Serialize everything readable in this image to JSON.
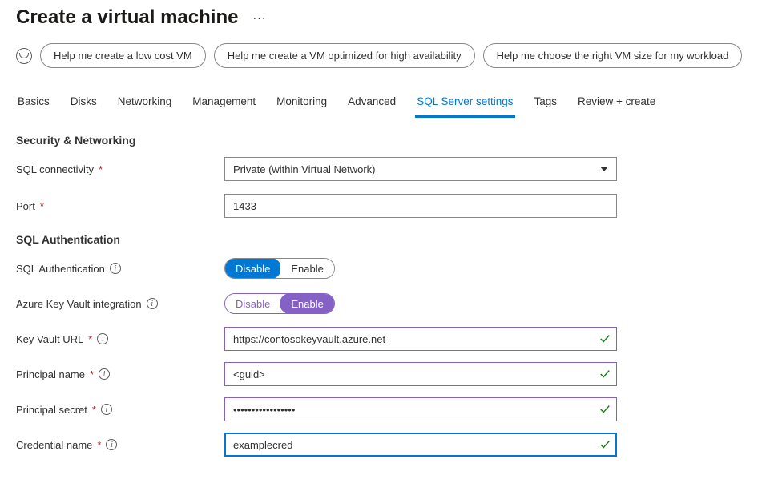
{
  "header": {
    "title": "Create a virtual machine"
  },
  "suggestions": {
    "items": [
      "Help me create a low cost VM",
      "Help me create a VM optimized for high availability",
      "Help me choose the right VM size for my workload"
    ]
  },
  "tabs": {
    "items": [
      "Basics",
      "Disks",
      "Networking",
      "Management",
      "Monitoring",
      "Advanced",
      "SQL Server settings",
      "Tags",
      "Review + create"
    ],
    "activeIndex": 6
  },
  "sectionSecurity": {
    "heading": "Security & Networking",
    "sqlConnectivityLabel": "SQL connectivity",
    "sqlConnectivityValue": "Private (within Virtual Network)",
    "portLabel": "Port",
    "portValue": "1433"
  },
  "sectionAuth": {
    "heading": "SQL Authentication",
    "sqlAuthLabel": "SQL Authentication",
    "akvLabel": "Azure Key Vault integration",
    "disableLabel": "Disable",
    "enableLabel": "Enable",
    "keyVaultUrlLabel": "Key Vault URL",
    "keyVaultUrlValue": "https://contosokeyvault.azure.net",
    "principalNameLabel": "Principal name",
    "principalNameValue": "<guid>",
    "principalSecretLabel": "Principal secret",
    "principalSecretValue": "•••••••••••••••••",
    "credentialNameLabel": "Credential name",
    "credentialNameValue": "examplecred"
  },
  "colors": {
    "accentBlue": "#0078d4",
    "accentPurple": "#8661c5",
    "validGreen": "#107c10",
    "requiredRed": "#a4262c"
  }
}
